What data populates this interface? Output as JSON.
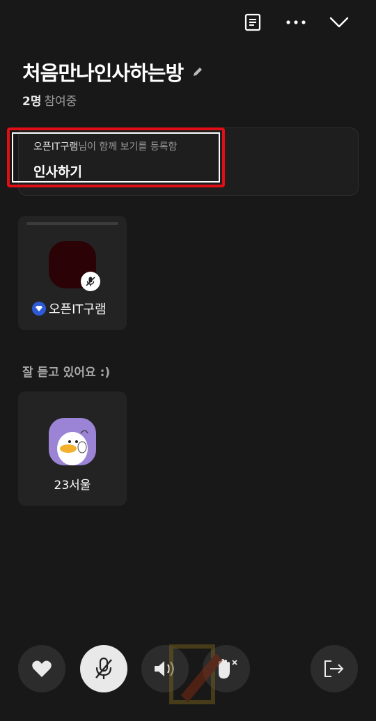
{
  "header": {
    "icons": [
      "notice-icon",
      "more-icon",
      "chevron-down-icon"
    ]
  },
  "room": {
    "title": "처음만나인사하는방",
    "participant_count": "2명",
    "participant_suffix": "참여중"
  },
  "watch_together": {
    "registrant": "오픈IT구램",
    "registered_text": "님이 함께 보기를 등록함",
    "title": "인사하기"
  },
  "speakers": [
    {
      "name": "오픈IT구램",
      "muted": true,
      "host": true,
      "avatar_color": "#2b0306"
    }
  ],
  "listening": {
    "label": "잘 듣고 있어요 :)",
    "members": [
      {
        "name": "23서울",
        "avatar_color": "#9b84d6"
      }
    ]
  },
  "controls": [
    "heart-icon",
    "mic-off-icon",
    "speaker-icon",
    "raise-hand-icon",
    "exit-icon"
  ],
  "colors": {
    "background": "#181818",
    "highlight": "#e00f16"
  }
}
